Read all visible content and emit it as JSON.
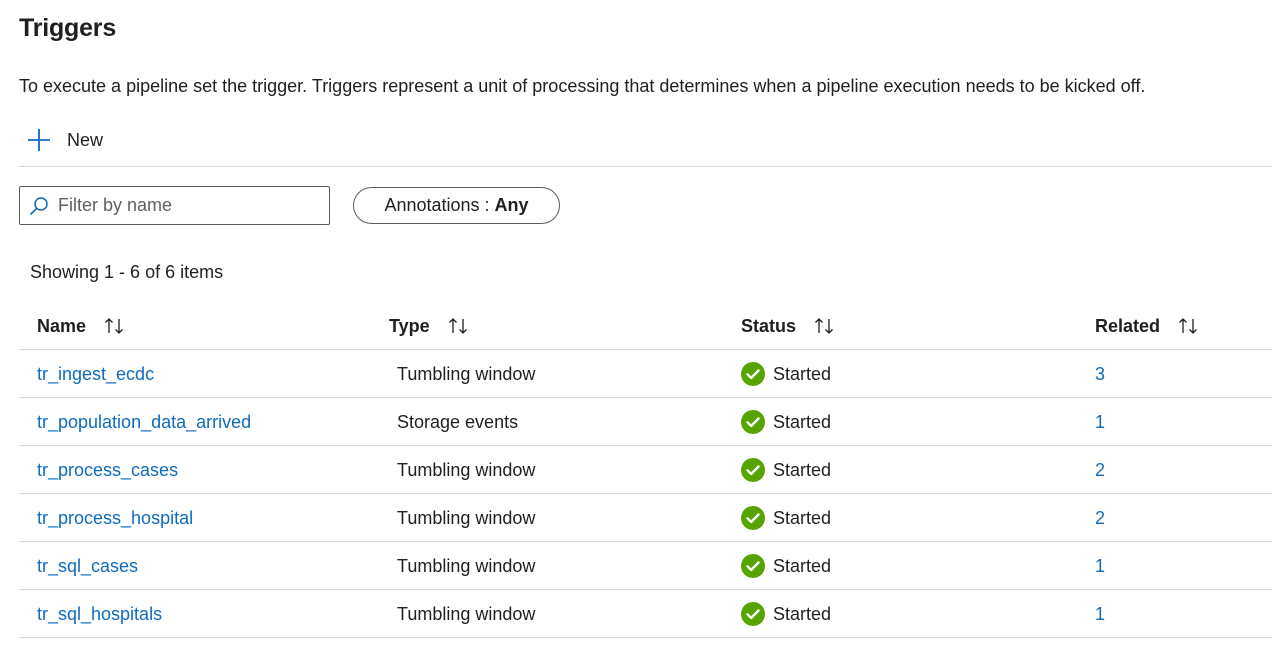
{
  "header": {
    "title": "Triggers",
    "description": "To execute a pipeline set the trigger. Triggers represent a unit of processing that determines when a pipeline execution needs to be kicked off."
  },
  "toolbar": {
    "new_label": "New"
  },
  "filter": {
    "placeholder": "Filter by name",
    "value": ""
  },
  "annotations_filter": {
    "label": "Annotations : ",
    "value": "Any"
  },
  "results": {
    "count_text": "Showing 1 - 6 of 6 items"
  },
  "table": {
    "columns": [
      {
        "label": "Name"
      },
      {
        "label": "Type"
      },
      {
        "label": "Status"
      },
      {
        "label": "Related"
      }
    ],
    "rows": [
      {
        "name": "tr_ingest_ecdc",
        "type": "Tumbling window",
        "status": "Started",
        "related": "3"
      },
      {
        "name": "tr_population_data_arrived",
        "type": "Storage events",
        "status": "Started",
        "related": "1"
      },
      {
        "name": "tr_process_cases",
        "type": "Tumbling window",
        "status": "Started",
        "related": "2"
      },
      {
        "name": "tr_process_hospital",
        "type": "Tumbling window",
        "status": "Started",
        "related": "2"
      },
      {
        "name": "tr_sql_cases",
        "type": "Tumbling window",
        "status": "Started",
        "related": "1"
      },
      {
        "name": "tr_sql_hospitals",
        "type": "Tumbling window",
        "status": "Started",
        "related": "1"
      }
    ]
  },
  "icons": {
    "new": "plus-icon",
    "filter": "search-icon",
    "sort": "sort-arrows-icon",
    "status": "checkmark-circle-icon"
  },
  "colors": {
    "link": "#0f6cbd",
    "success": "#57a300",
    "accent": "#0f6cbd",
    "divider": "#d6d6d6"
  }
}
